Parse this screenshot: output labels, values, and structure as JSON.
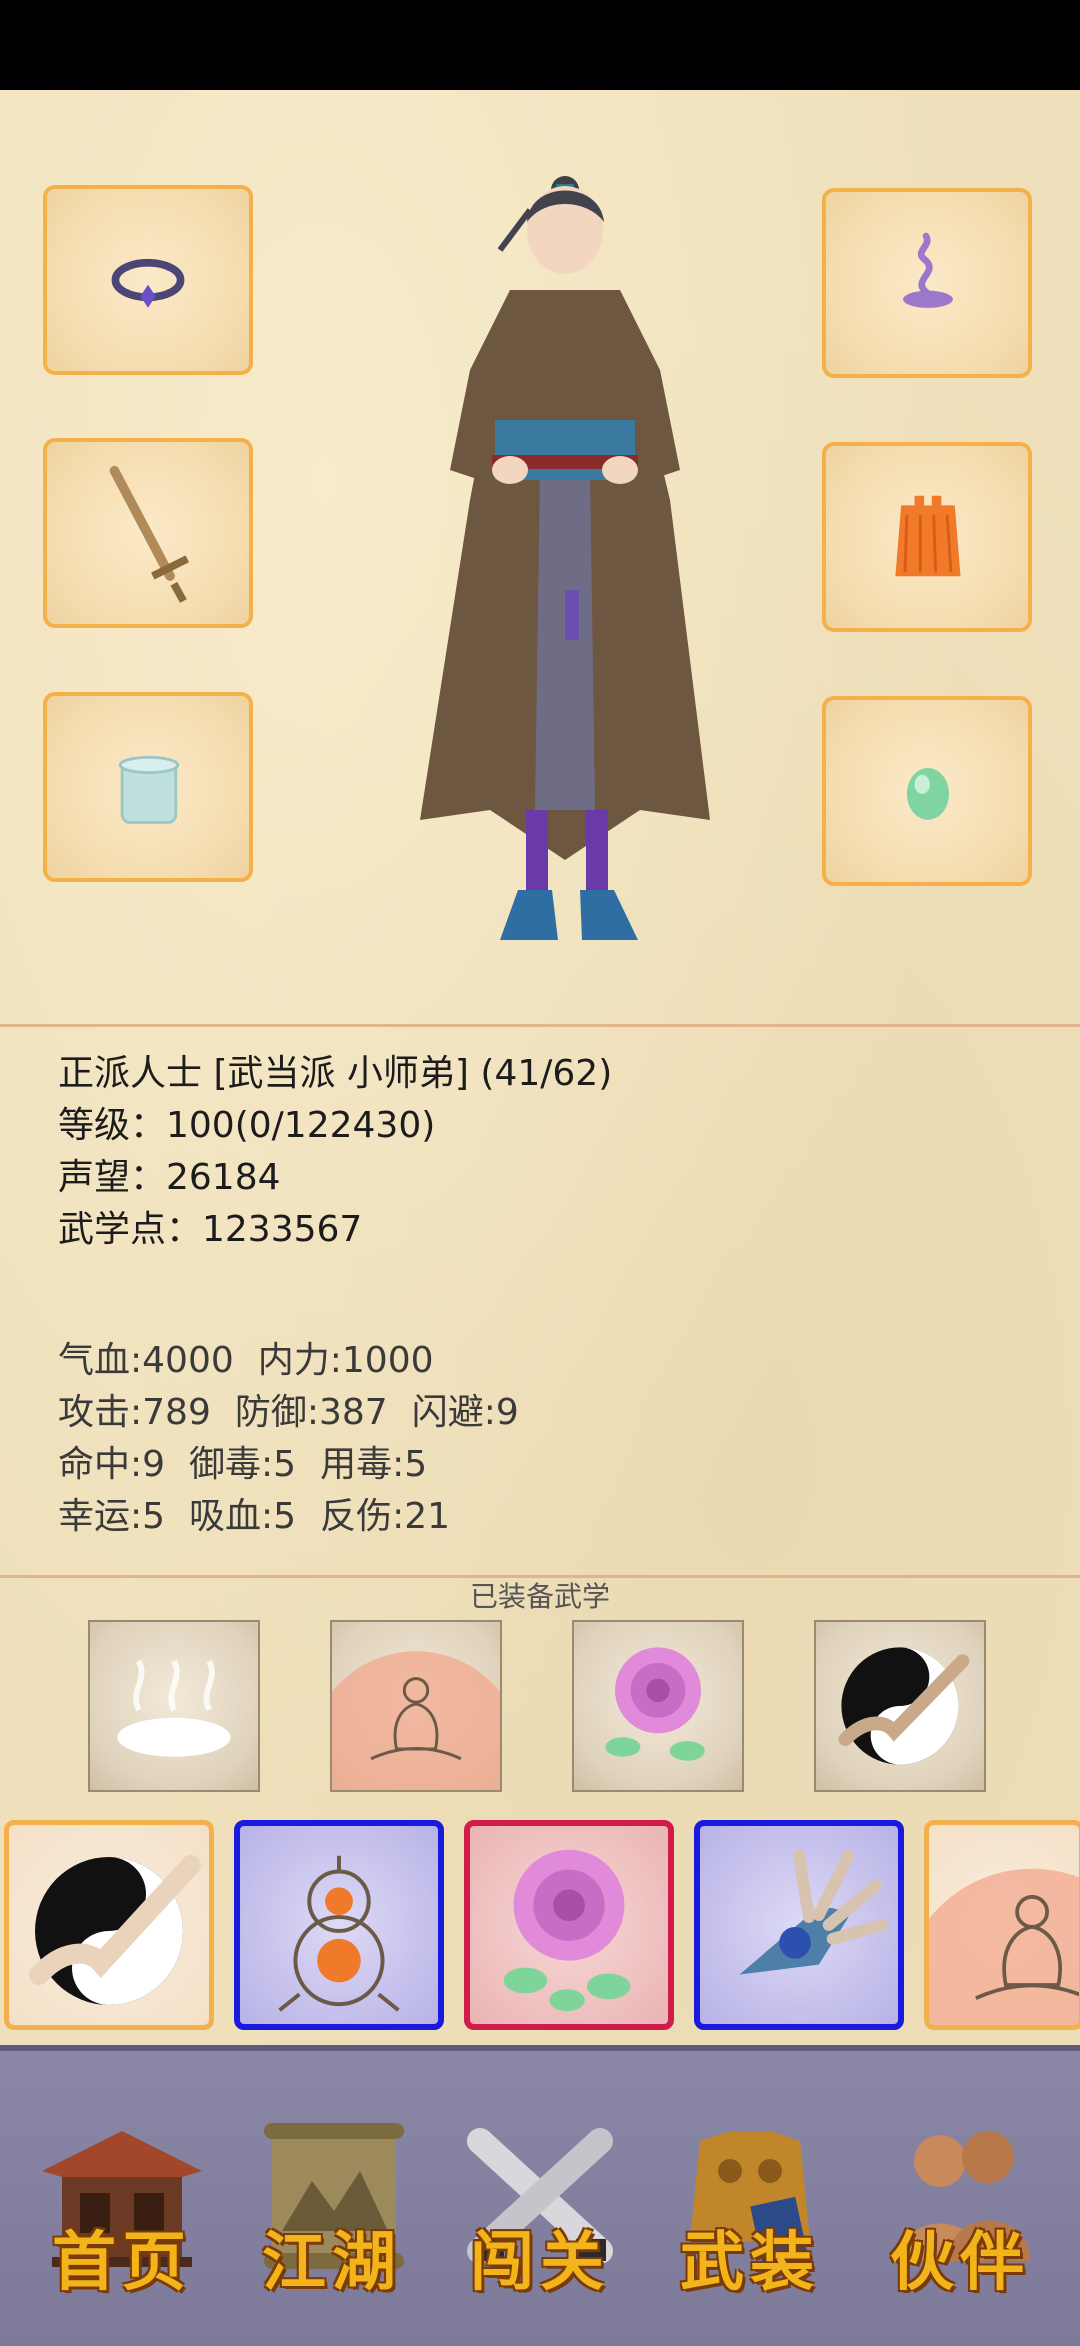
{
  "equipment": {
    "left_slots": [
      "ring-icon",
      "sword-icon",
      "bracer-icon"
    ],
    "right_slots": [
      "incense-icon",
      "robe-icon",
      "jade-icon"
    ]
  },
  "character": {
    "title_line": "正派人士 [武当派 小师弟] (41/62)",
    "level_line": "等级：100(0/122430)",
    "fame_line": "声望：26184",
    "martial_points_line": "武学点：1233567"
  },
  "stats": {
    "row1": [
      "气血:4000",
      "内力:1000"
    ],
    "row2": [
      "攻击:789",
      "防御:387",
      "闪避:9"
    ],
    "row3": [
      "命中:9",
      "御毒:5",
      "用毒:5"
    ],
    "row4": [
      "幸运:5",
      "吸血:5",
      "反伤:21"
    ]
  },
  "equipped_martial": {
    "title": "已装备武学",
    "items": [
      "mist-icon",
      "meditation-icon",
      "peony-icon",
      "taiji-palm-icon"
    ]
  },
  "skills": [
    {
      "icon": "taiji-palm-icon",
      "rarity": "orange"
    },
    {
      "icon": "gourd-icon",
      "rarity": "blue"
    },
    {
      "icon": "peony-icon",
      "rarity": "red"
    },
    {
      "icon": "claw-icon",
      "rarity": "blue"
    },
    {
      "icon": "meditation-icon",
      "rarity": "orange"
    }
  ],
  "nav": {
    "home": "首页",
    "jianghu": "江湖",
    "challenge": "闯关",
    "gear": "武装",
    "partner": "伙伴"
  },
  "colors": {
    "paper": "#efe0bb",
    "slot_border": "#f4b04a",
    "blue_border": "#1a1adf",
    "red_border": "#d11b4b",
    "nav_bg": "#8a87a6",
    "nav_text": "#f2b41a"
  }
}
